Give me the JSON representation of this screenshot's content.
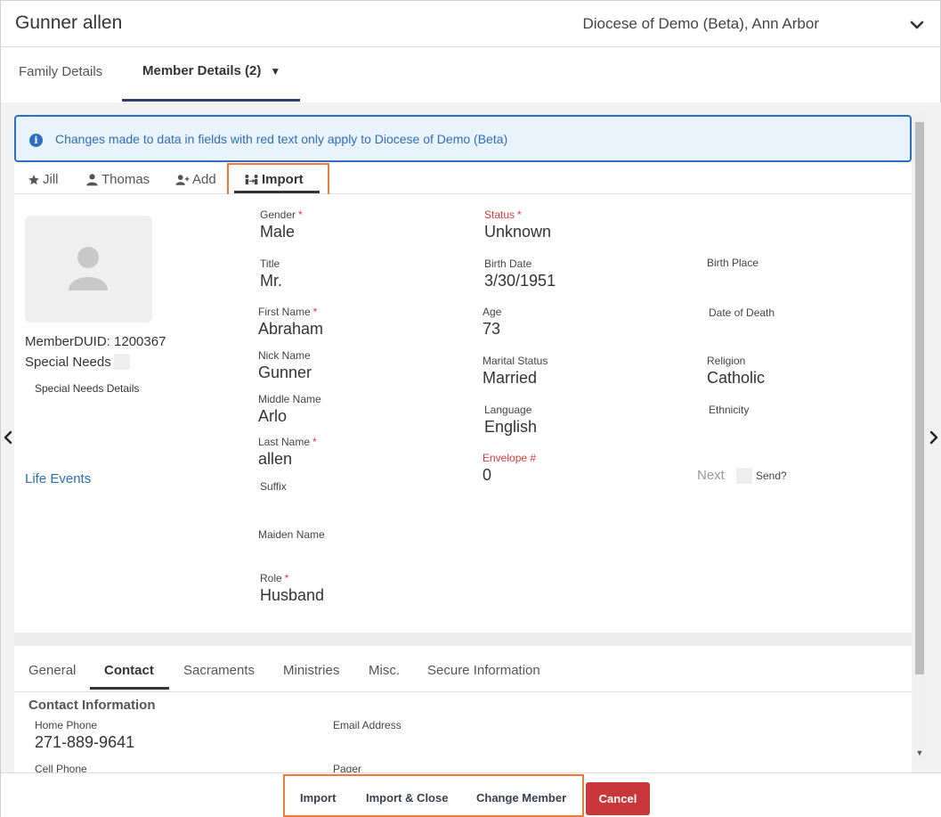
{
  "header": {
    "title": "Gunner allen",
    "diocese": "Diocese of Demo (Beta), Ann Arbor"
  },
  "top_tabs": [
    {
      "label": "Family Details"
    },
    {
      "label": "Member Details (2)",
      "caret": "▼"
    }
  ],
  "info_banner": {
    "text": "Changes made to data in fields with red text only apply to Diocese of Demo (Beta)"
  },
  "member_tabs": {
    "jill": "Jill",
    "thomas": "Thomas",
    "add": "Add",
    "import": "Import"
  },
  "member": {
    "duid_label": "MemberDUID: 1200367",
    "special_needs_label": "Special Needs",
    "special_needs_details_label": "Special Needs Details",
    "life_events_label": "Life Events"
  },
  "fields": {
    "gender": {
      "label": "Gender",
      "value": "Male"
    },
    "title": {
      "label": "Title",
      "value": "Mr."
    },
    "first_name": {
      "label": "First Name",
      "value": "Abraham"
    },
    "nick_name": {
      "label": "Nick Name",
      "value": "Gunner"
    },
    "middle_name": {
      "label": "Middle Name",
      "value": "Arlo"
    },
    "last_name": {
      "label": "Last Name",
      "value": "allen"
    },
    "suffix": {
      "label": "Suffix",
      "value": ""
    },
    "maiden_name": {
      "label": "Maiden Name",
      "value": ""
    },
    "role": {
      "label": "Role",
      "value": "Husband"
    },
    "status": {
      "label": "Status",
      "value": "Unknown"
    },
    "birth_date": {
      "label": "Birth Date",
      "value": "3/30/1951"
    },
    "age": {
      "label": "Age",
      "value": "73"
    },
    "marital_status": {
      "label": "Marital Status",
      "value": "Married"
    },
    "language": {
      "label": "Language",
      "value": "English"
    },
    "envelope": {
      "label": "Envelope #",
      "value": "0"
    },
    "birth_place": {
      "label": "Birth Place",
      "value": ""
    },
    "date_of_death": {
      "label": "Date of Death",
      "value": ""
    },
    "religion": {
      "label": "Religion",
      "value": "Catholic"
    },
    "ethnicity": {
      "label": "Ethnicity",
      "value": ""
    }
  },
  "next_label": "Next",
  "send_label": "Send?",
  "required_mark": "*",
  "sub_tabs": {
    "general": "General",
    "contact": "Contact",
    "sacraments": "Sacraments",
    "ministries": "Ministries",
    "misc": "Misc.",
    "secure": "Secure Information"
  },
  "contact": {
    "title": "Contact Information",
    "home_phone": {
      "label": "Home Phone",
      "value": "271-889-9641"
    },
    "email": {
      "label": "Email Address",
      "value": ""
    },
    "cell_phone": {
      "label": "Cell Phone",
      "value": ""
    },
    "pager": {
      "label": "Pager",
      "value": ""
    }
  },
  "footer": {
    "import": "Import",
    "import_close": "Import & Close",
    "change_member": "Change Member",
    "cancel": "Cancel"
  },
  "colors": {
    "accent_blue": "#2c6fbf",
    "required_red": "#d93a3a",
    "highlight_orange": "#ee7a3a",
    "cancel_red": "#c9373a"
  }
}
